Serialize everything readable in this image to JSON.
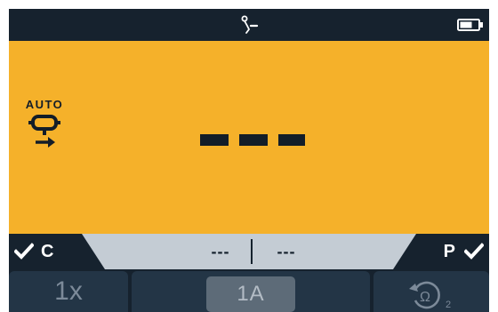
{
  "status_bar": {
    "center_icon": "lead-test-icon",
    "battery_icon": "battery-icon",
    "background": "#16222e"
  },
  "display": {
    "background": "#f5b12a",
    "mode_label": "AUTO",
    "mode_icon": "continuity-auto-icon",
    "reading": "---"
  },
  "limit_bar": {
    "left": {
      "check_icon": "check-icon",
      "label": "C"
    },
    "center_low": "---",
    "center_high": "---",
    "right": {
      "label": "P",
      "check_icon": "check-icon"
    }
  },
  "softkeys": {
    "multiplier": "1x",
    "range": "1A",
    "reverse_icon": "ohm-reverse-icon",
    "reverse_subscript": "2"
  }
}
